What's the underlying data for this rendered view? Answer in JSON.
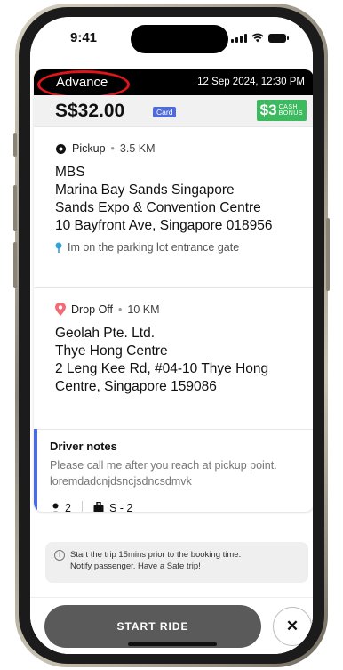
{
  "status_bar": {
    "time": "9:41"
  },
  "booking": {
    "type_label": "Advance",
    "datetime": "12 Sep 2024, 12:30 PM",
    "fare": "S$32.00",
    "payment_method": "Card",
    "bonus_amount": "$3",
    "bonus_label_line1": "CASH",
    "bonus_label_line2": "BONUS"
  },
  "pickup": {
    "label": "Pickup",
    "distance": "3.5 KM",
    "address_lines": [
      "MBS",
      "Marina Bay Sands Singapore",
      "Sands Expo & Convention Centre",
      "10 Bayfront Ave, Singapore 018956"
    ],
    "note": "Im on the parking lot entrance gate"
  },
  "dropoff": {
    "label": "Drop Off",
    "distance": "10 KM",
    "address_lines": [
      "Geolah Pte. Ltd.",
      "Thye Hong Centre",
      "2 Leng Kee Rd, #04-10 Thye Hong",
      "Centre, Singapore 159086"
    ]
  },
  "driver_notes": {
    "title": "Driver notes",
    "text": "Please call me after you reach at pickup point. loremdadcnjdsncjsdncsdmvk",
    "passengers": "2",
    "luggage": "S - 2"
  },
  "info": {
    "line1": "Start the trip 15mins prior to the booking time.",
    "line2": "Notify passenger. Have a Safe trip!"
  },
  "actions": {
    "start_label": "START RIDE",
    "close_label": "✕"
  },
  "colors": {
    "accent_blue": "#4a6ce0",
    "bonus_green": "#3db95f",
    "highlight_red": "#e0141b",
    "pickup_pin": "#2fa3d8",
    "dropoff_pin": "#f26b75",
    "button_gray": "#5a5a5a"
  },
  "icons": {
    "pickup": "target-dot-icon",
    "parking_note": "location-pin-icon",
    "dropoff": "map-pin-icon",
    "passengers": "person-icon",
    "luggage": "luggage-icon",
    "info": "info-icon",
    "close": "close-icon"
  }
}
